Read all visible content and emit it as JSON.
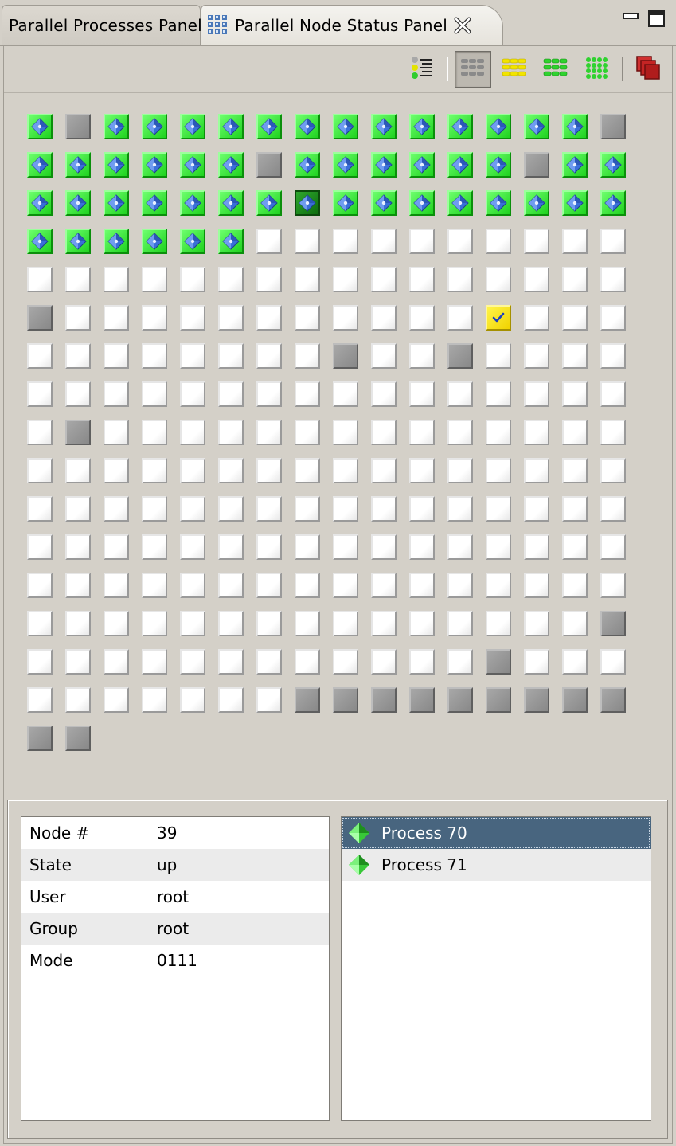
{
  "tabs": {
    "inactive_label": "Parallel Processes Panel",
    "active_label": "Parallel Node Status Panel"
  },
  "toolbar": {
    "buttons": [
      {
        "name": "legend",
        "icon": "legend-icon"
      },
      {
        "name": "small-grid",
        "icon": "gray-grid-icon",
        "pressed": true
      },
      {
        "name": "yellow-grid",
        "icon": "yellow-grid-icon"
      },
      {
        "name": "green-grid",
        "icon": "green-grid-icon"
      },
      {
        "name": "dense-grid",
        "icon": "dense-green-grid-icon"
      },
      {
        "name": "terminate",
        "icon": "red-stack-icon"
      }
    ]
  },
  "colors": {
    "running": "#1fd21f",
    "down": "#888888",
    "empty": "#ffffff",
    "user": "#f1d300",
    "selection": "#48657f"
  },
  "grid": {
    "columns": 16,
    "legend": "R = running (green w/ process icon), S = selected running, D = down (gray), U = user-owned (yellow w/ check), E = empty",
    "rows": [
      "RDRRRRRRRRRRRRRD",
      "RRRRRRDRRRRRRDRR",
      "RRRRRRRSRRRRRRRR",
      "RRRRRREEEEEEEEEE",
      "EEEEEEEEEEEEEEEE",
      "DEEEEEEEEEEEUEEE",
      "EEEEEEEEDEEDEEEE",
      "EEEEEEEEEEEEEEEE",
      "EDEEEEEEEEEEEEEE",
      "EEEEEEEEEEEEEEEE",
      "EEEEEEEEEEEEEEEE",
      "EEEEEEEEEEEEEEEE",
      "EEEEEEEEEEEEEEEE",
      "EEEEEEEEEEEEEEED",
      "EEEEEEEEEEEEDEEE",
      "EEEEEEEDDDDDDDDD",
      "DD"
    ]
  },
  "attributes": [
    {
      "key": "Node #",
      "value": "39"
    },
    {
      "key": "State",
      "value": "up"
    },
    {
      "key": "User",
      "value": "root"
    },
    {
      "key": "Group",
      "value": "root"
    },
    {
      "key": "Mode",
      "value": "0111"
    }
  ],
  "processes": [
    {
      "label": "Process 70",
      "selected": true
    },
    {
      "label": "Process 71",
      "selected": false
    }
  ]
}
